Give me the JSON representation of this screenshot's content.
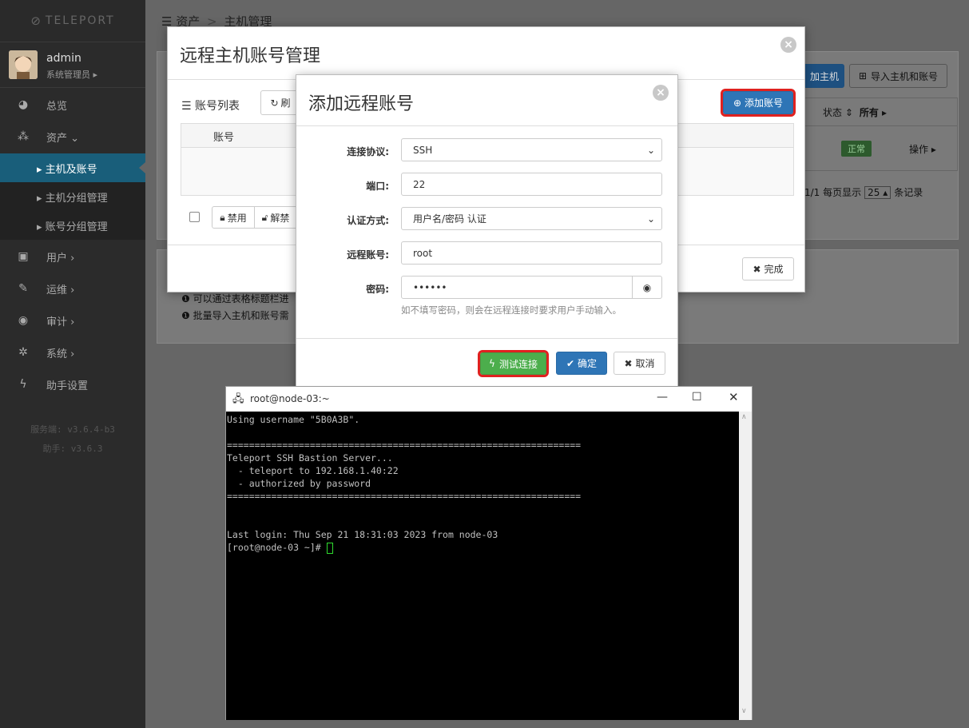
{
  "app": {
    "logo_text": "TELEPORT"
  },
  "user": {
    "name": "admin",
    "role": "系统管理员 ▸"
  },
  "nav": [
    {
      "icon": "dashboard-icon",
      "glyph": "◕",
      "label": "总览"
    },
    {
      "icon": "assets-icon",
      "glyph": "⁂",
      "label": "资产 ⌄"
    },
    {
      "label": "▸ 主机及账号"
    },
    {
      "label": "▸ 主机分组管理"
    },
    {
      "label": "▸ 账号分组管理"
    },
    {
      "icon": "user-icon",
      "glyph": "▣",
      "label": "用户 ›"
    },
    {
      "icon": "wrench-icon",
      "glyph": "✎",
      "label": "运维 ›"
    },
    {
      "icon": "eye-icon",
      "glyph": "◉",
      "label": "审计 ›"
    },
    {
      "icon": "gear-icon",
      "glyph": "✲",
      "label": "系统 ›"
    },
    {
      "icon": "bolt-icon",
      "glyph": "ϟ",
      "label": "助手设置"
    }
  ],
  "versions": {
    "server": "服务端: v3.6.4-b3",
    "assist": "助手: v3.6.3"
  },
  "breadcrumb": {
    "root": "资产",
    "sep": ">",
    "current": "主机管理"
  },
  "host_page": {
    "add_host": "加主机",
    "import_label": "导入主机和账号",
    "status_header": "状态 ⇕",
    "all_filter": "所有 ▸",
    "status_ok": "正常",
    "op_label": "操作 ▸",
    "pager_text": "1/1  每页显示",
    "page_size": "25 ▴",
    "records": "条记录",
    "tip1": "可以通过表格标题栏进",
    "tip2": "批量导入主机和账号需"
  },
  "account_dialog": {
    "title": "远程主机账号管理",
    "list_label": "账号列表",
    "refresh": "刷",
    "add_account": "添加账号",
    "col_account": "账号",
    "disable": "禁用",
    "unlock": "解禁",
    "done": "完成"
  },
  "add_dialog": {
    "title": "添加远程账号",
    "protocol_label": "连接协议:",
    "protocol_value": "SSH",
    "port_label": "端口:",
    "port_value": "22",
    "auth_label": "认证方式:",
    "auth_value": "用户名/密码 认证",
    "account_label": "远程账号:",
    "account_value": "root",
    "password_label": "密码:",
    "password_value": "••••••",
    "password_hint": "如不填写密码，则会在远程连接时要求用户手动输入。",
    "test_btn": "测试连接",
    "ok_btn": "确定",
    "cancel_btn": "取消"
  },
  "putty": {
    "title": "root@node-03:~",
    "lines": [
      "Using username \"5B0A3B\".",
      "",
      "================================================================",
      "Teleport SSH Bastion Server...",
      "  - teleport to 192.168.1.40:22",
      "  - authorized by password",
      "================================================================",
      "",
      "",
      "Last login: Thu Sep 21 18:31:03 2023 from node-03",
      "[root@node-03 ~]# "
    ]
  },
  "colors": {
    "highlight": "#e0211f",
    "primary": "#2e75b6",
    "success": "#4cae4c",
    "sidebar_active": "#195e7a"
  }
}
